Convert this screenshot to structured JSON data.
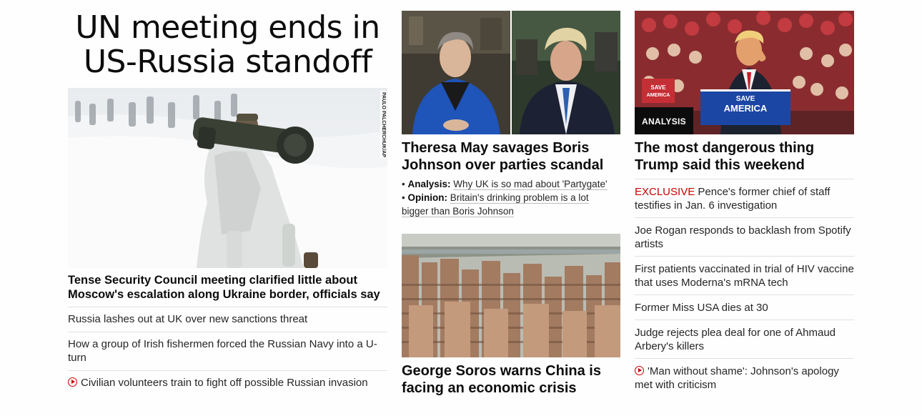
{
  "hero": {
    "headline_line1": "UN meeting ends in",
    "headline_line2": "US-Russia standoff",
    "photo_credit": "PAULO PALCHERCHUK/AP",
    "lead_headline": "Tense Security Council meeting clarified little about Moscow's escalation along Ukraine border, officials say",
    "related": [
      {
        "text": "Russia lashes out at UK over new sanctions threat"
      },
      {
        "text": "How a group of Irish fishermen forced the Russian Navy into a U-turn"
      },
      {
        "text": "Civilian volunteers train to fight off possible Russian invasion",
        "icon": "play-video-icon"
      }
    ]
  },
  "middle": {
    "story1": {
      "headline": "Theresa May savages Boris Johnson over parties scandal",
      "bullets": [
        {
          "label": "Analysis:",
          "text": "Why UK is so mad about 'Partygate'"
        },
        {
          "label": "Opinion:",
          "text": "Britain's drinking problem is a lot bigger than Boris Johnson"
        }
      ]
    },
    "story2": {
      "headline": "George Soros warns China is facing an economic crisis"
    }
  },
  "right": {
    "badge": "ANALYSIS",
    "headline": "The most dangerous thing Trump said this weekend",
    "podium_line1": "SAVE",
    "podium_line2": "AMERICA",
    "sign_text": "SAVE AMERICA",
    "links": [
      {
        "prefix": "EXCLUSIVE",
        "text": "Pence's former chief of staff testifies in Jan. 6 investigation"
      },
      {
        "text": "Joe Rogan responds to backlash from Spotify artists"
      },
      {
        "text": "First patients vaccinated in trial of HIV vaccine that uses Moderna's mRNA tech"
      },
      {
        "text": "Former Miss USA dies at 30"
      },
      {
        "text": "Judge rejects plea deal for one of Ahmaud Arbery's killers"
      },
      {
        "text": "'Man without shame': Johnson's apology met with criticism",
        "icon": "play-video-icon"
      }
    ]
  },
  "colors": {
    "text": "#0c0c0c",
    "exclusive_red": "#cc0000",
    "divider": "#e1e1e1",
    "badge_bg": "#0c0c0c"
  }
}
